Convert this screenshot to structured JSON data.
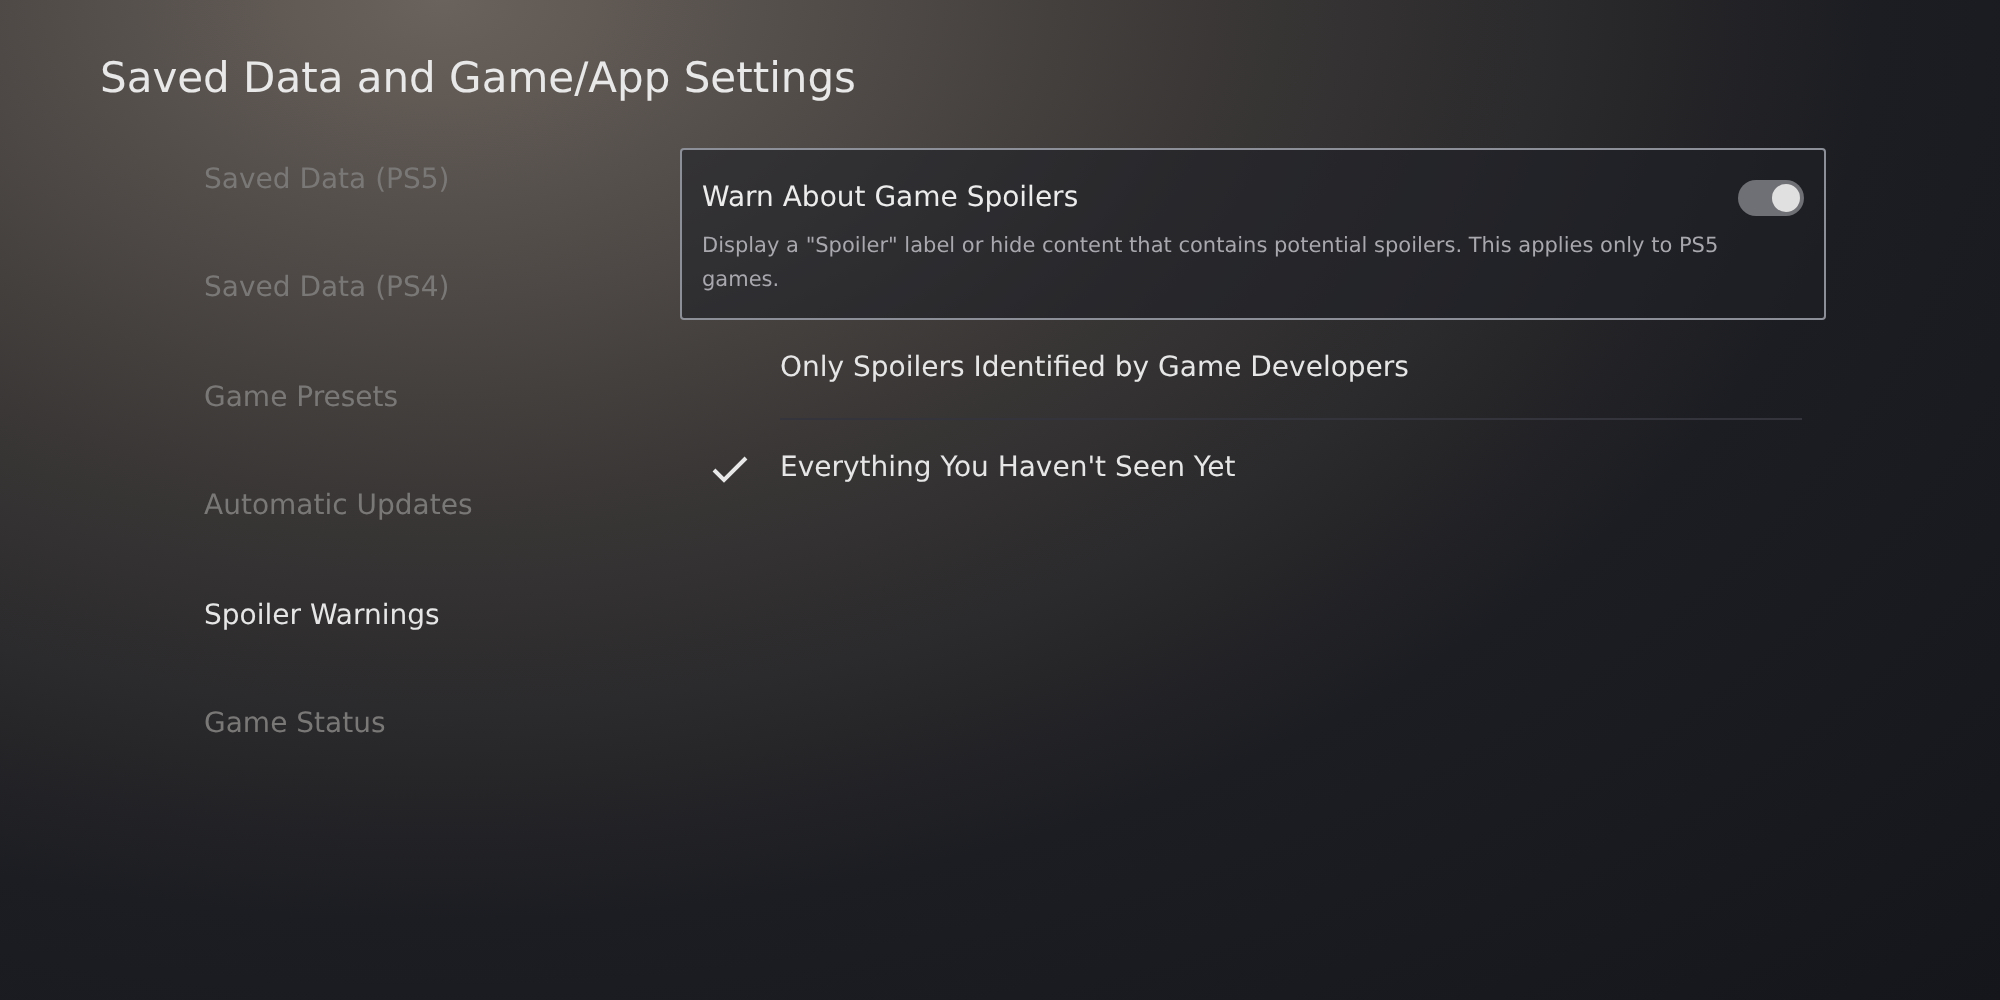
{
  "title": "Saved Data and Game/App Settings",
  "sidebar": {
    "items": [
      {
        "label": "Saved Data (PS5)",
        "selected": false
      },
      {
        "label": "Saved Data (PS4)",
        "selected": false
      },
      {
        "label": "Game Presets",
        "selected": false
      },
      {
        "label": "Automatic Updates",
        "selected": false
      },
      {
        "label": "Spoiler Warnings",
        "selected": true
      },
      {
        "label": "Game Status",
        "selected": false
      }
    ]
  },
  "setting": {
    "label": "Warn About Game Spoilers",
    "description": "Display a \"Spoiler\" label or hide content that contains potential spoilers. This applies only to PS5 games.",
    "on": true
  },
  "options": [
    {
      "label": "Only Spoilers Identified by Game Developers",
      "selected": false
    },
    {
      "label": "Everything You Haven't Seen Yet",
      "selected": true
    }
  ]
}
